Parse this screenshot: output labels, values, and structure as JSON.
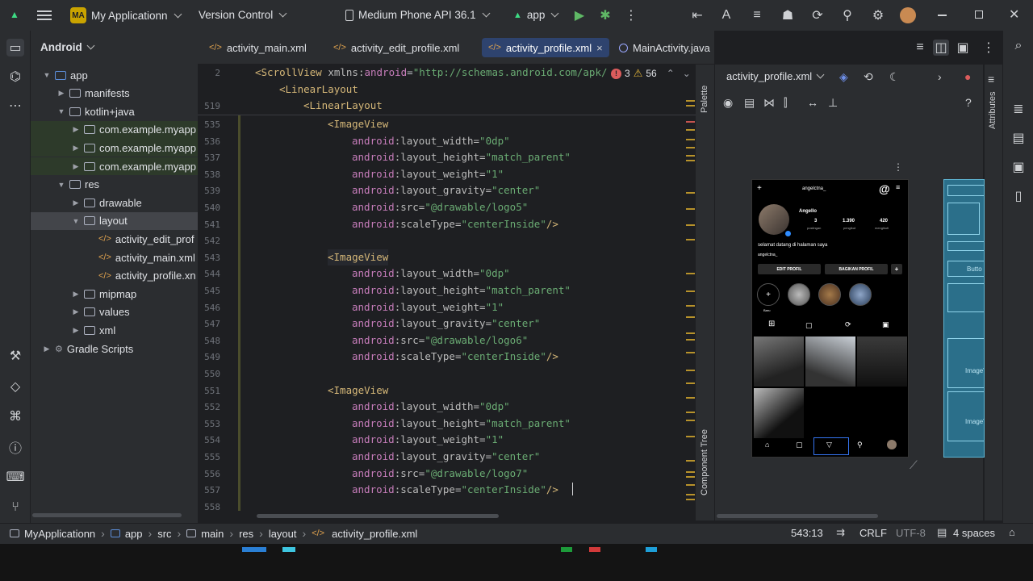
{
  "titlebar": {
    "project_badge": "MA",
    "project_name": "My Applicationn",
    "vcs": "Version Control",
    "device": "Medium Phone API 36.1",
    "run_config": "app"
  },
  "project_panel": {
    "view": "Android",
    "tree": [
      {
        "label": "app",
        "depth": 0,
        "expanded": true,
        "icon": "module-folder-icon"
      },
      {
        "label": "manifests",
        "depth": 1,
        "expanded": false,
        "icon": "folder-icon"
      },
      {
        "label": "kotlin+java",
        "depth": 1,
        "expanded": true,
        "icon": "folder-icon"
      },
      {
        "label": "com.example.myapp",
        "depth": 2,
        "expanded": false,
        "icon": "package-icon"
      },
      {
        "label": "com.example.myapp",
        "depth": 2,
        "expanded": false,
        "icon": "package-icon"
      },
      {
        "label": "com.example.myapp",
        "depth": 2,
        "expanded": false,
        "icon": "package-icon"
      },
      {
        "label": "res",
        "depth": 1,
        "expanded": true,
        "icon": "folder-icon"
      },
      {
        "label": "drawable",
        "depth": 2,
        "expanded": false,
        "icon": "folder-icon"
      },
      {
        "label": "layout",
        "depth": 2,
        "expanded": true,
        "icon": "folder-icon"
      },
      {
        "label": "activity_edit_prof",
        "depth": 3,
        "icon": "xml-file-icon"
      },
      {
        "label": "activity_main.xml",
        "depth": 3,
        "icon": "xml-file-icon"
      },
      {
        "label": "activity_profile.xn",
        "depth": 3,
        "icon": "xml-file-icon"
      },
      {
        "label": "mipmap",
        "depth": 2,
        "expanded": false,
        "icon": "folder-icon"
      },
      {
        "label": "values",
        "depth": 2,
        "expanded": false,
        "icon": "folder-icon"
      },
      {
        "label": "xml",
        "depth": 2,
        "expanded": false,
        "icon": "folder-icon"
      },
      {
        "label": "Gradle Scripts",
        "depth": 0,
        "expanded": false,
        "icon": "gradle-icon"
      }
    ]
  },
  "tabs": [
    {
      "label": "activity_main.xml",
      "type": "xml",
      "active": false
    },
    {
      "label": "activity_edit_profile.xml",
      "type": "xml",
      "active": false
    },
    {
      "label": "activity_profile.xml",
      "type": "xml",
      "active": true
    },
    {
      "label": "MainActivity.java",
      "type": "java",
      "active": false
    }
  ],
  "inspection": {
    "errors": "3",
    "warnings": "56"
  },
  "code": {
    "sticky": [
      {
        "num": "2",
        "indent": 0,
        "tokens": [
          [
            "t-tag",
            "<ScrollView "
          ],
          [
            "t-attr",
            "xmlns:"
          ],
          [
            "t-ns",
            "android"
          ],
          [
            "t-plain",
            "="
          ],
          [
            "t-val",
            "\"http://schemas.android.com/apk/"
          ]
        ]
      },
      {
        "num": "",
        "indent": 1,
        "tokens": [
          [
            "t-tag",
            "<LinearLayout"
          ]
        ]
      },
      {
        "num": "519",
        "indent": 2,
        "tokens": [
          [
            "t-tag",
            "<LinearLayout"
          ]
        ]
      }
    ],
    "lines": [
      {
        "num": "535",
        "indent": 3,
        "tokens": [
          [
            "t-tag",
            "<ImageView"
          ]
        ]
      },
      {
        "num": "536",
        "indent": 4,
        "tokens": [
          [
            "t-ns",
            "android"
          ],
          [
            "t-attr",
            ":layout_width="
          ],
          [
            "t-val",
            "\"0dp\""
          ]
        ]
      },
      {
        "num": "537",
        "indent": 4,
        "tokens": [
          [
            "t-ns",
            "android"
          ],
          [
            "t-attr",
            ":layout_height="
          ],
          [
            "t-val",
            "\"match_parent\""
          ]
        ]
      },
      {
        "num": "538",
        "indent": 4,
        "tokens": [
          [
            "t-ns",
            "android"
          ],
          [
            "t-attr",
            ":layout_weight="
          ],
          [
            "t-val",
            "\"1\""
          ]
        ]
      },
      {
        "num": "539",
        "indent": 4,
        "tokens": [
          [
            "t-ns",
            "android"
          ],
          [
            "t-attr",
            ":layout_gravity="
          ],
          [
            "t-val",
            "\"center\""
          ]
        ]
      },
      {
        "num": "540",
        "indent": 4,
        "tokens": [
          [
            "t-ns",
            "android"
          ],
          [
            "t-attr",
            ":src="
          ],
          [
            "t-val",
            "\"@drawable/logo5\""
          ]
        ]
      },
      {
        "num": "541",
        "indent": 4,
        "tokens": [
          [
            "t-ns",
            "android"
          ],
          [
            "t-attr",
            ":scaleType="
          ],
          [
            "t-val",
            "\"centerInside\""
          ],
          [
            "t-tag",
            "/>"
          ]
        ]
      },
      {
        "num": "542",
        "indent": 0,
        "tokens": []
      },
      {
        "num": "543",
        "indent": 3,
        "tokens": [
          [
            "t-tag",
            "<ImageView"
          ]
        ]
      },
      {
        "num": "544",
        "indent": 4,
        "tokens": [
          [
            "t-ns",
            "android"
          ],
          [
            "t-attr",
            ":layout_width="
          ],
          [
            "t-val",
            "\"0dp\""
          ]
        ]
      },
      {
        "num": "545",
        "indent": 4,
        "tokens": [
          [
            "t-ns",
            "android"
          ],
          [
            "t-attr",
            ":layout_height="
          ],
          [
            "t-val",
            "\"match_parent\""
          ]
        ]
      },
      {
        "num": "546",
        "indent": 4,
        "tokens": [
          [
            "t-ns",
            "android"
          ],
          [
            "t-attr",
            ":layout_weight="
          ],
          [
            "t-val",
            "\"1\""
          ]
        ]
      },
      {
        "num": "547",
        "indent": 4,
        "tokens": [
          [
            "t-ns",
            "android"
          ],
          [
            "t-attr",
            ":layout_gravity="
          ],
          [
            "t-val",
            "\"center\""
          ]
        ]
      },
      {
        "num": "548",
        "indent": 4,
        "tokens": [
          [
            "t-ns",
            "android"
          ],
          [
            "t-attr",
            ":src="
          ],
          [
            "t-val",
            "\"@drawable/logo6\""
          ]
        ]
      },
      {
        "num": "549",
        "indent": 4,
        "tokens": [
          [
            "t-ns",
            "android"
          ],
          [
            "t-attr",
            ":scaleType="
          ],
          [
            "t-val",
            "\"centerInside\""
          ],
          [
            "t-tag",
            "/>"
          ]
        ]
      },
      {
        "num": "550",
        "indent": 0,
        "tokens": []
      },
      {
        "num": "551",
        "indent": 3,
        "tokens": [
          [
            "t-tag",
            "<ImageView"
          ]
        ]
      },
      {
        "num": "552",
        "indent": 4,
        "tokens": [
          [
            "t-ns",
            "android"
          ],
          [
            "t-attr",
            ":layout_width="
          ],
          [
            "t-val",
            "\"0dp\""
          ]
        ]
      },
      {
        "num": "553",
        "indent": 4,
        "tokens": [
          [
            "t-ns",
            "android"
          ],
          [
            "t-attr",
            ":layout_height="
          ],
          [
            "t-val",
            "\"match_parent\""
          ]
        ]
      },
      {
        "num": "554",
        "indent": 4,
        "tokens": [
          [
            "t-ns",
            "android"
          ],
          [
            "t-attr",
            ":layout_weight="
          ],
          [
            "t-val",
            "\"1\""
          ]
        ]
      },
      {
        "num": "555",
        "indent": 4,
        "tokens": [
          [
            "t-ns",
            "android"
          ],
          [
            "t-attr",
            ":layout_gravity="
          ],
          [
            "t-val",
            "\"center\""
          ]
        ]
      },
      {
        "num": "556",
        "indent": 4,
        "tokens": [
          [
            "t-ns",
            "android"
          ],
          [
            "t-attr",
            ":src="
          ],
          [
            "t-val",
            "\"@drawable/logo7\""
          ]
        ]
      },
      {
        "num": "557",
        "indent": 4,
        "tokens": [
          [
            "t-ns",
            "android"
          ],
          [
            "t-attr",
            ":scaleType="
          ],
          [
            "t-val",
            "\"centerInside\""
          ],
          [
            "t-tag",
            "/>"
          ]
        ]
      },
      {
        "num": "558",
        "indent": 0,
        "tokens": []
      }
    ]
  },
  "design": {
    "file": "activity_profile.xml",
    "palette": "Palette",
    "component_tree": "Component Tree",
    "attributes": "Attributes"
  },
  "phone": {
    "username": "angelctna_",
    "name": "Angello",
    "posts": "3",
    "posts_label": "postingan",
    "followers": "1.390",
    "followers_label": "pengikut",
    "following": "420",
    "following_label": "mengikuti",
    "bio": "selamat datang di halaman saya",
    "link": "angelctna_",
    "edit_btn": "EDIT PROFIL",
    "share_btn": "BAGIKAN PROFIL",
    "story_new": "Baru"
  },
  "blueprint": {
    "labels": [
      "Butto",
      "ImageView",
      "ImageView"
    ]
  },
  "statusbar": {
    "crumbs": [
      "MyApplicationn",
      "app",
      "src",
      "main",
      "res",
      "layout",
      "activity_profile.xml"
    ],
    "position": "543:13",
    "line_sep": "CRLF",
    "encoding": "UTF-8",
    "indent": "4 spaces"
  },
  "colors": {
    "accent": "#3574f0",
    "bg_editor": "#1e1f22",
    "bg_panel": "#2b2d30",
    "xml_tag": "#d5b778",
    "xml_value": "#6aab73",
    "xml_namespace": "#c77dbb"
  }
}
